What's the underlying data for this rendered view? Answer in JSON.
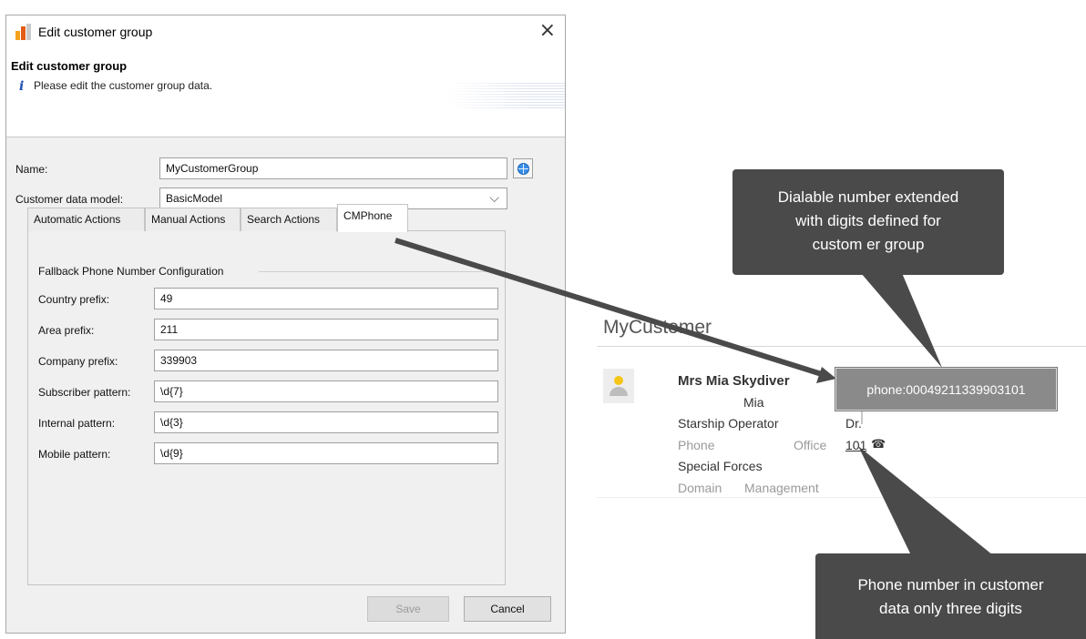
{
  "dialog": {
    "window_title": "Edit customer group",
    "header_title": "Edit customer group",
    "header_description": "Please edit the customer group data.",
    "name_label": "Name:",
    "name_value": "MyCustomerGroup",
    "model_label": "Customer data model:",
    "model_value": "BasicModel",
    "tabs": [
      {
        "label": "Automatic Actions"
      },
      {
        "label": "Manual Actions"
      },
      {
        "label": "Search Actions"
      },
      {
        "label": "CMPhone",
        "active": true
      }
    ],
    "section_title": "Fallback Phone Number Configuration",
    "fields": [
      {
        "label": "Country prefix:",
        "value": "49"
      },
      {
        "label": "Area prefix:",
        "value": "211"
      },
      {
        "label": "Company prefix:",
        "value": "339903"
      },
      {
        "label": "Subscriber pattern:",
        "value": "\\d{7}"
      },
      {
        "label": "Internal pattern:",
        "value": "\\d{3}"
      },
      {
        "label": "Mobile pattern:",
        "value": "\\d{9}"
      }
    ],
    "save_label": "Save",
    "cancel_label": "Cancel"
  },
  "customer_card": {
    "title": "MyCustomer",
    "name": "Mrs Mia Skydiver",
    "first_name": "Mia",
    "job_title": "Starship Operator",
    "dr_label": "Dr.",
    "phone_label": "Phone",
    "office_label": "Office",
    "phone_number": "101",
    "phone_icon": "☎",
    "department": "Special Forces",
    "domain_label": "Domain",
    "management_label": "Management"
  },
  "callouts": {
    "top": [
      "Dialable number extended",
      "with digits defined for",
      "custom er group"
    ],
    "tooltip": "phone:00049211339903101",
    "bottom": [
      "Phone number in customer",
      "data only three digits"
    ]
  },
  "colors": {
    "callout_bg": "#4a4a4a",
    "tooltip_bg": "#8a8a8a",
    "arrow": "#4a4a4a"
  }
}
